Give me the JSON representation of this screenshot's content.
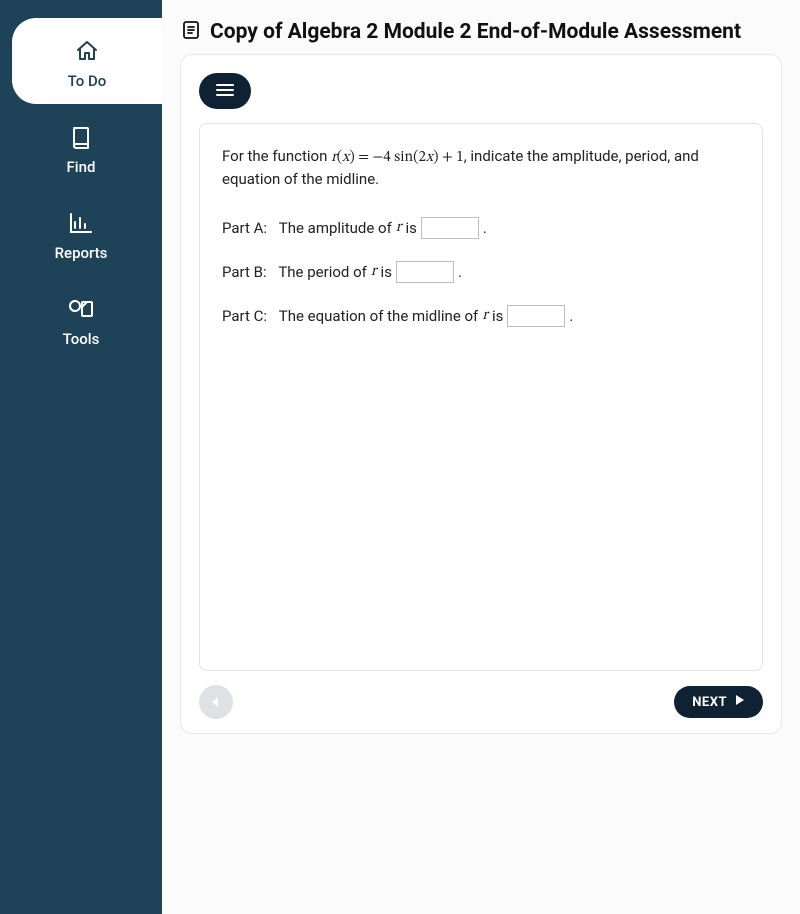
{
  "sidebar": {
    "items": [
      {
        "id": "todo",
        "label": "To Do",
        "active": true
      },
      {
        "id": "find",
        "label": "Find",
        "active": false
      },
      {
        "id": "reports",
        "label": "Reports",
        "active": false
      },
      {
        "id": "tools",
        "label": "Tools",
        "active": false
      }
    ]
  },
  "header": {
    "title": "Copy of Algebra 2 Module 2 End-of-Module Assessment"
  },
  "question": {
    "prompt_prefix": "For the function ",
    "function_expr": "r(x) = −4 sin(2x) + 1",
    "prompt_suffix": ", indicate the amplitude, period, and equation of the midline.",
    "parts": [
      {
        "label": "Part A:",
        "text_before": "The amplitude of ",
        "var": "r",
        "text_after": " is ",
        "value": ""
      },
      {
        "label": "Part B:",
        "text_before": "The period of ",
        "var": "r",
        "text_after": " is ",
        "value": ""
      },
      {
        "label": "Part C:",
        "text_before": "The equation of the midline of ",
        "var": "r",
        "text_after": " is ",
        "value": ""
      }
    ]
  },
  "nav": {
    "next_label": "NEXT"
  }
}
